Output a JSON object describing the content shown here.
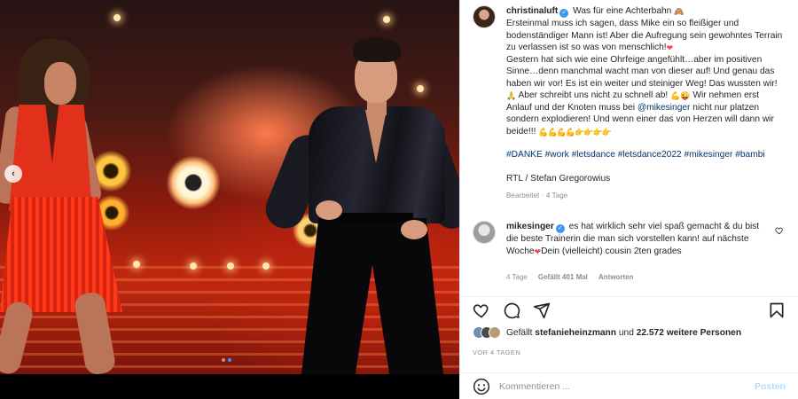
{
  "post": {
    "author": "christinaluft",
    "caption_first": "Was für eine Achterbahn",
    "caption_p1": "Ersteinmal muss ich sagen, dass Mike ein so fleißiger und bodenständiger Mann ist! Aber die Aufregung sein gewohntes Terrain zu verlassen ist so was von menschlich!",
    "caption_p2": "Gestern hat sich wie eine Ohrfeige angefühlt…aber im positiven Sinne…denn manchmal wacht man von dieser auf! Und genau das haben wir vor! Es ist ein weiter und steiniger Weg! Das wussten wir!",
    "caption_p3": "Aber schreibt uns nicht zu schnell ab!",
    "caption_p3b": "Wir nehmen erst Anlauf und der Knoten muss bei",
    "mention": "@mikesinger",
    "caption_p4": "nicht nur platzen sondern explodieren! Und wenn einer das von Herzen will dann wir beide!!!",
    "emoji_row": "💪💪💪💪👉👉👉👉",
    "hashtags": "#DANKE #work #letsdance #letsdance2022 #mikesinger #bambi",
    "credit": "RTL / Stefan Gregorowius",
    "edited": "Bearbeitet · 4 Tage"
  },
  "comment": {
    "author": "mikesinger",
    "text": "es hat wirklich sehr viel spaß gemacht & du bist die beste Trainerin die man sich vorstellen kann! auf nächste Woche",
    "text_end": "Dein (vielleicht) cousin 2ten grades",
    "time": "4 Tage",
    "likes": "Gefällt 401 Mal",
    "reply": "Antworten"
  },
  "likes": {
    "prefix": "Gefällt",
    "user": "stefanieheinzmann",
    "middle": "und",
    "count": "22.572 weitere Personen"
  },
  "timestamp": "VOR 4 TAGEN",
  "composer": {
    "placeholder": "Kommentieren ...",
    "post_label": "Posten"
  },
  "icons": [
    "heart-icon",
    "comment-icon",
    "share-icon",
    "bookmark-icon",
    "emoji-icon",
    "verified-icon",
    "chevron-left-icon"
  ],
  "colors": {
    "link": "#00376b",
    "verified": "#3897f0",
    "muted": "#8e8e8e",
    "post_disabled": "#b3dbff"
  }
}
